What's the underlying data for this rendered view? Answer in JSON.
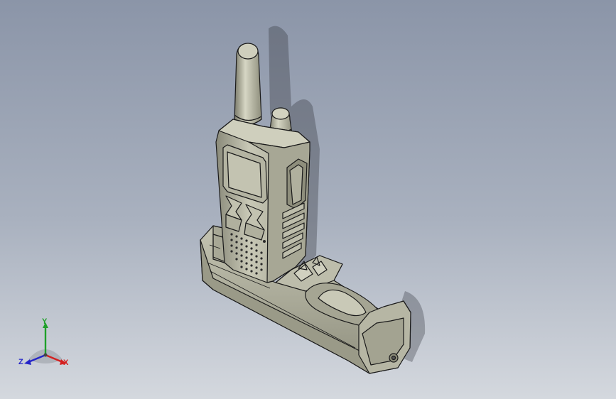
{
  "viewport": {
    "background_top": "#8b95a8",
    "background_bottom": "#d4d8de",
    "model_name": "walkie-talkie-with-charging-dock",
    "model_color": "#b8b8a6",
    "edge_color": "#1a1a1a"
  },
  "triad": {
    "x_label": "X",
    "y_label": "Y",
    "z_label": "Z",
    "x_color": "#d42020",
    "y_color": "#1fa02a",
    "z_color": "#2424c8"
  }
}
